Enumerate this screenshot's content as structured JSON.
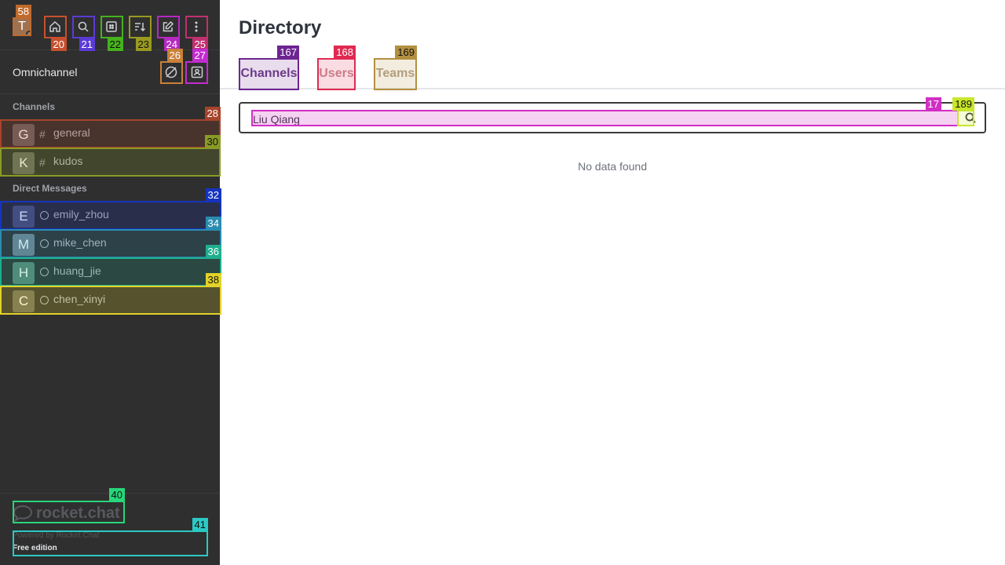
{
  "user": {
    "initial": "T"
  },
  "sidebar": {
    "omnichannel_label": "Omnichannel",
    "channels_title": "Channels",
    "dm_title": "Direct Messages",
    "channels": [
      {
        "initial": "G",
        "name": "general",
        "color": "#5c4040"
      },
      {
        "initial": "K",
        "name": "kudos",
        "color": "#5b5b45"
      }
    ],
    "direct_messages": [
      {
        "initial": "E",
        "name": "emily_zhou",
        "color": "#3b4364"
      },
      {
        "initial": "M",
        "name": "mike_chen",
        "color": "#56707c"
      },
      {
        "initial": "H",
        "name": "huang_jie",
        "color": "#4d7065"
      },
      {
        "initial": "C",
        "name": "chen_xinyi",
        "color": "#5e5a48"
      }
    ],
    "brand": "rocket.chat",
    "powered_by": "Powered by Rocket.Chat",
    "edition": "Free edition"
  },
  "directory": {
    "title": "Directory",
    "tabs": [
      {
        "label": "Channels",
        "active": true
      },
      {
        "label": "Users",
        "active": false
      },
      {
        "label": "Teams",
        "active": false
      }
    ],
    "search_value": "Liu Qiang",
    "empty_message": "No data found"
  },
  "annotations": [
    "58",
    "20",
    "21",
    "22",
    "23",
    "24",
    "25",
    "26",
    "27",
    "28",
    "30",
    "32",
    "34",
    "36",
    "38",
    "40",
    "41",
    "167",
    "168",
    "169",
    "17",
    "189"
  ]
}
